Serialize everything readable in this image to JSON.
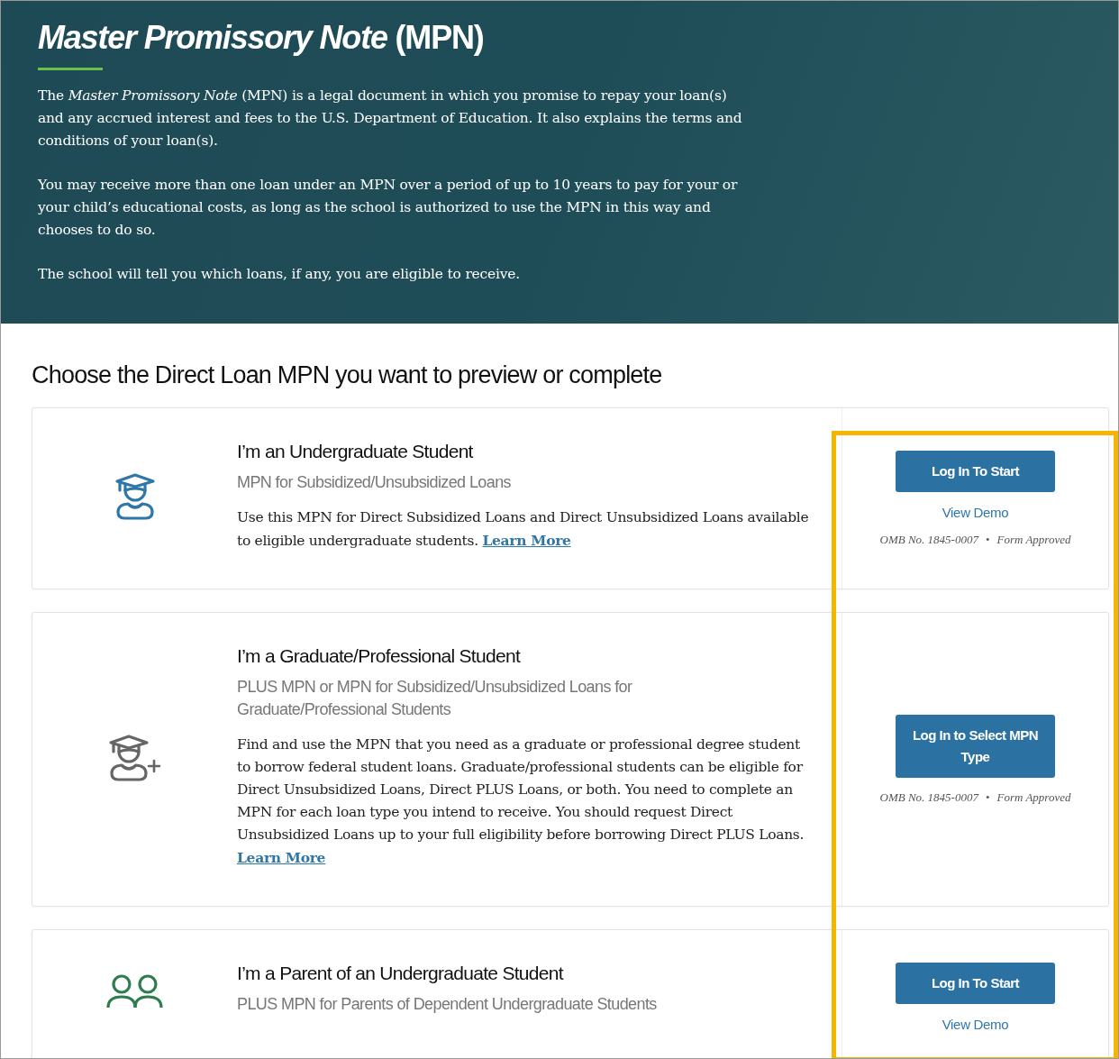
{
  "hero": {
    "title": "*Master Promissory Note* (MPN)",
    "paragraphs": [
      "The *Master Promissory Note* (MPN) is a legal document in which you promise to repay your loan(s) and any accrued interest and fees to the U.S. Department of Education. It also explains the terms and conditions of your loan(s).",
      "You may receive more than one loan under an MPN over a period of up to 10 years to pay for your or your child’s educational costs, as long as the school is authorized to use the MPN in this way and chooses to do so.",
      "The school will tell you which loans, if any, you are eligible to receive."
    ]
  },
  "section_title": "Choose the Direct Loan MPN you want to preview or complete",
  "cards": [
    {
      "kind": "student",
      "color": "#2f77a8",
      "title": "I’m an Undergraduate Student",
      "subtitle": "MPN for Subsidized/Unsubsidized Loans",
      "description": "Use this MPN for Direct Subsidized Loans and Direct Unsubsidized Loans available to eligible undergraduate students.",
      "link": "Learn More",
      "button": "Log In To Start",
      "demo": "View Demo",
      "omb": "OMB No. 1845-0007",
      "separator": "•",
      "approval": "Form Approved"
    },
    {
      "kind": "student-plus",
      "color": "#666666",
      "title": "I’m a Graduate/Professional Student",
      "subtitle": "PLUS MPN or MPN for Subsidized/Unsubsidized Loans for Graduate/Professional Students",
      "description": "Find and use the MPN that you need as a graduate or professional degree student to borrow federal student loans. Graduate/professional students can be eligible for Direct Unsubsidized Loans, Direct PLUS Loans, or both. You need to complete an MPN for each loan type you intend to receive. You should request Direct Unsubsidized Loans up to your full eligibility before borrowing Direct PLUS Loans.",
      "link": "Learn More",
      "button": "Log In to Select MPN Type",
      "omb": "OMB No. 1845-0007",
      "separator": "•",
      "approval": "Form Approved"
    },
    {
      "kind": "parents",
      "color": "#2e7d4f",
      "title": "I’m a Parent of an Undergraduate Student",
      "subtitle": "PLUS MPN for Parents of Dependent Undergraduate Students",
      "button": "Log In To Start",
      "demo": "View Demo"
    }
  ]
}
